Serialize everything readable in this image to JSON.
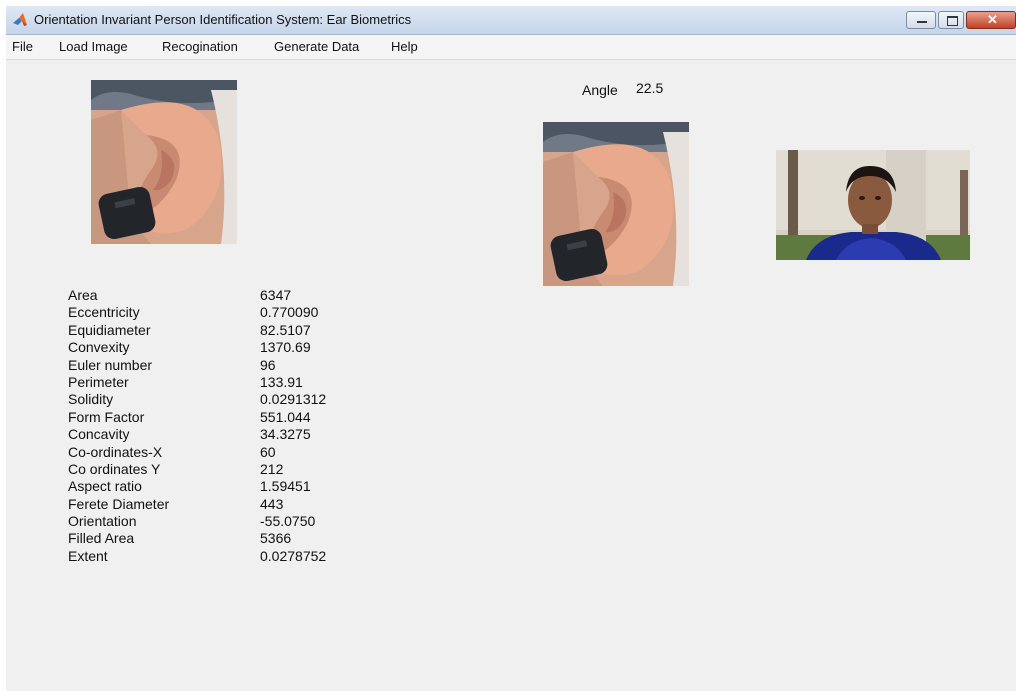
{
  "window": {
    "title": "Orientation Invariant Person Identification System: Ear Biometrics",
    "app_icon": "matlab-logo-icon",
    "controls": [
      "minimize-icon",
      "maximize-icon",
      "close-icon"
    ]
  },
  "menu": {
    "items": [
      {
        "label": "File"
      },
      {
        "label": "Load Image"
      },
      {
        "label": "Recogination"
      },
      {
        "label": "Generate Data"
      },
      {
        "label": "Help"
      }
    ]
  },
  "angle": {
    "label": "Angle",
    "value": "22.5"
  },
  "images": {
    "input_ear": "photo-ear-input",
    "rotated_ear": "photo-ear-rotated",
    "matched_person": "photo-person-match"
  },
  "properties": [
    {
      "name": "Area",
      "value": "6347"
    },
    {
      "name": "Eccentricity",
      "value": "0.770090"
    },
    {
      "name": "Equidiameter",
      "value": "82.5107"
    },
    {
      "name": "Convexity",
      "value": "1370.69"
    },
    {
      "name": "Euler number",
      "value": "96"
    },
    {
      "name": "Perimeter",
      "value": "133.91"
    },
    {
      "name": "Solidity",
      "value": "0.0291312"
    },
    {
      "name": "Form Factor",
      "value": "551.044"
    },
    {
      "name": "Concavity",
      "value": "34.3275"
    },
    {
      "name": "Co-ordinates-X",
      "value": "60"
    },
    {
      "name": "Co ordinates Y",
      "value": "212"
    },
    {
      "name": "Aspect ratio",
      "value": "1.59451"
    },
    {
      "name": "Ferete Diameter",
      "value": "443"
    },
    {
      "name": "Orientation",
      "value": "-55.0750"
    },
    {
      "name": "Filled Area",
      "value": "5366"
    },
    {
      "name": "Extent",
      "value": "0.0278752"
    }
  ]
}
